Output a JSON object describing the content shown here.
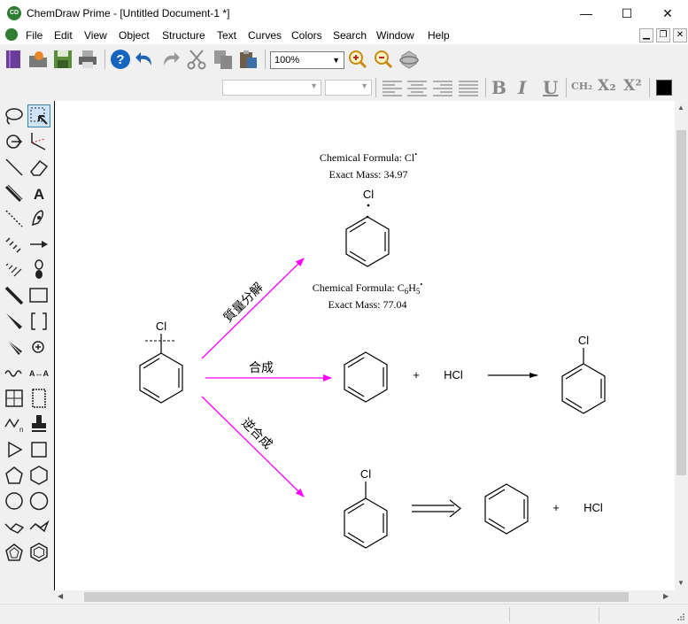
{
  "window": {
    "title": "ChemDraw Prime - [Untitled Document-1 *]",
    "app_icon_text": "CD",
    "minimize": "—",
    "maximize": "☐",
    "close": "✕"
  },
  "menu": {
    "items": [
      "File",
      "Edit",
      "View",
      "Object",
      "Structure",
      "Text",
      "Curves",
      "Colors",
      "Search",
      "Window",
      "Help"
    ],
    "mdi_buttons": [
      "▁",
      "❐",
      "✕"
    ]
  },
  "toolbar": {
    "zoom": "100%",
    "format_buttons": [
      "B",
      "I",
      "U",
      "CH₂",
      "X₂",
      "X²"
    ],
    "color_swatch": "#000000"
  },
  "canvas": {
    "colors": {
      "arrow_magenta": "#ff00ff",
      "bond": "#000000"
    },
    "top_product": {
      "formula_label": "Chemical Formula: Cl",
      "formula_dot": "•",
      "mass_label": "Exact Mass: 34.97",
      "atom": "Cl"
    },
    "mid_fragment": {
      "formula_prefix": "Chemical Formula: C",
      "formula_sub1": "6",
      "formula_mid": "H",
      "formula_sub2": "5",
      "formula_dot": "•",
      "mass_label": "Exact Mass: 77.04"
    },
    "reactant_atom": "Cl",
    "arrow_labels": {
      "top": "質量分解",
      "middle": "合成",
      "bottom": "逆合成"
    },
    "middle_row": {
      "plus": "+",
      "reagent": "HCl",
      "product_atom": "Cl"
    },
    "bottom_row": {
      "start_atom": "Cl",
      "plus": "+",
      "reagent": "HCl"
    }
  },
  "scrollbars": {
    "up": "▲",
    "down": "▼",
    "left": "◀",
    "right": "▶"
  }
}
